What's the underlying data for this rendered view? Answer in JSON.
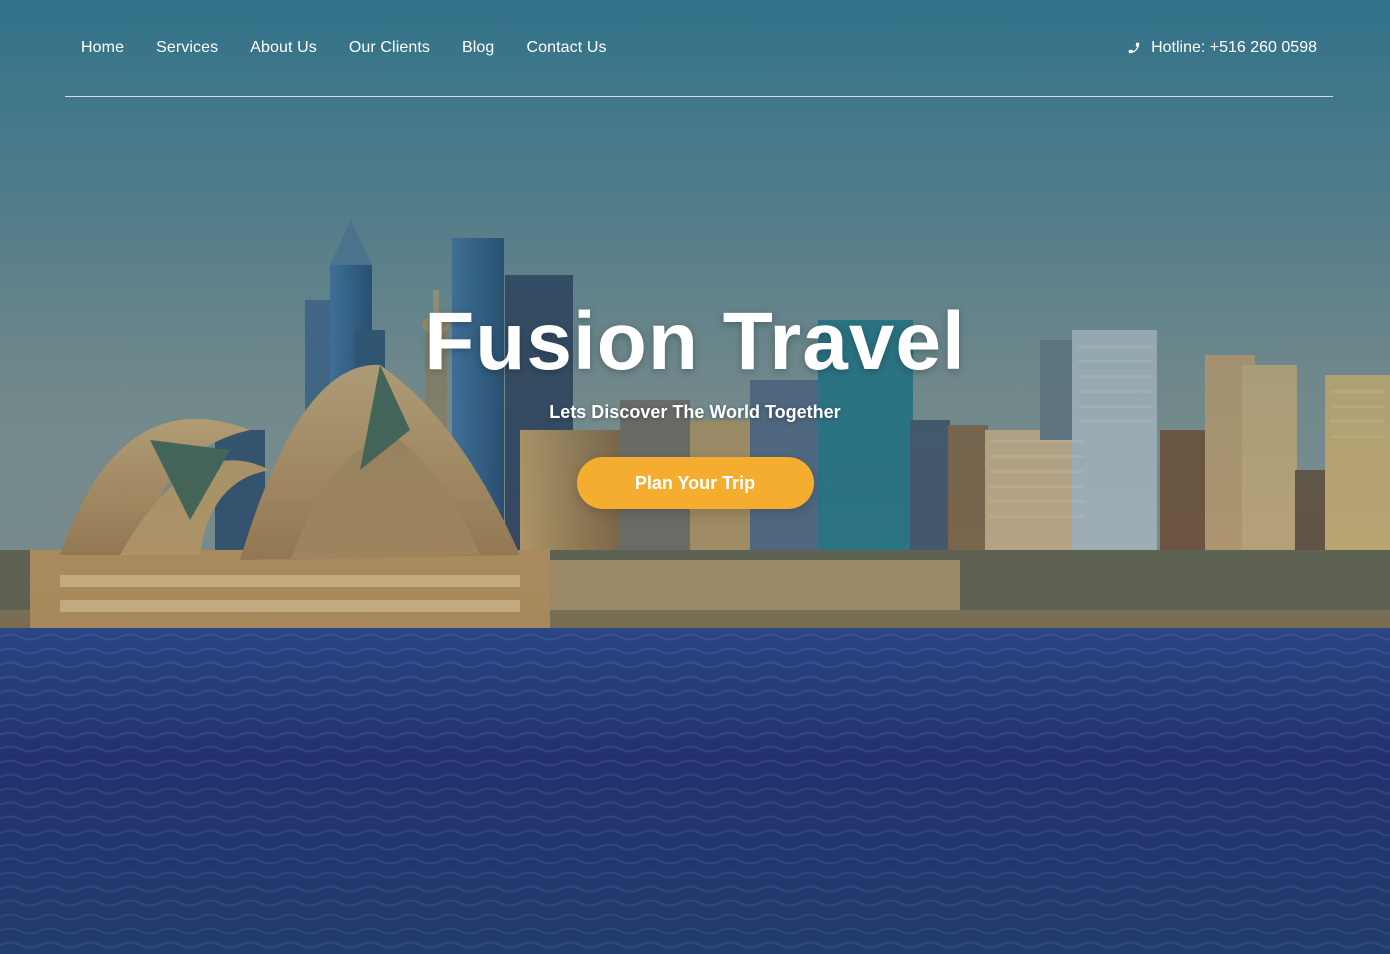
{
  "nav": {
    "items": [
      {
        "label": "Home"
      },
      {
        "label": "Services"
      },
      {
        "label": "About Us"
      },
      {
        "label": "Our Clients"
      },
      {
        "label": "Blog"
      },
      {
        "label": "Contact Us"
      }
    ],
    "hotline": {
      "text": "Hotline: +516 260 0598",
      "icon": "phone-icon"
    }
  },
  "hero": {
    "title": "Fusion Travel",
    "subtitle": "Lets Discover The World Together",
    "cta_label": "Plan Your Trip",
    "background": "sydney-harbour-skyline-photo"
  },
  "colors": {
    "accent": "#f5ad30",
    "text": "#ffffff",
    "sky": "#3f7f96",
    "water": "#2b3f83"
  }
}
